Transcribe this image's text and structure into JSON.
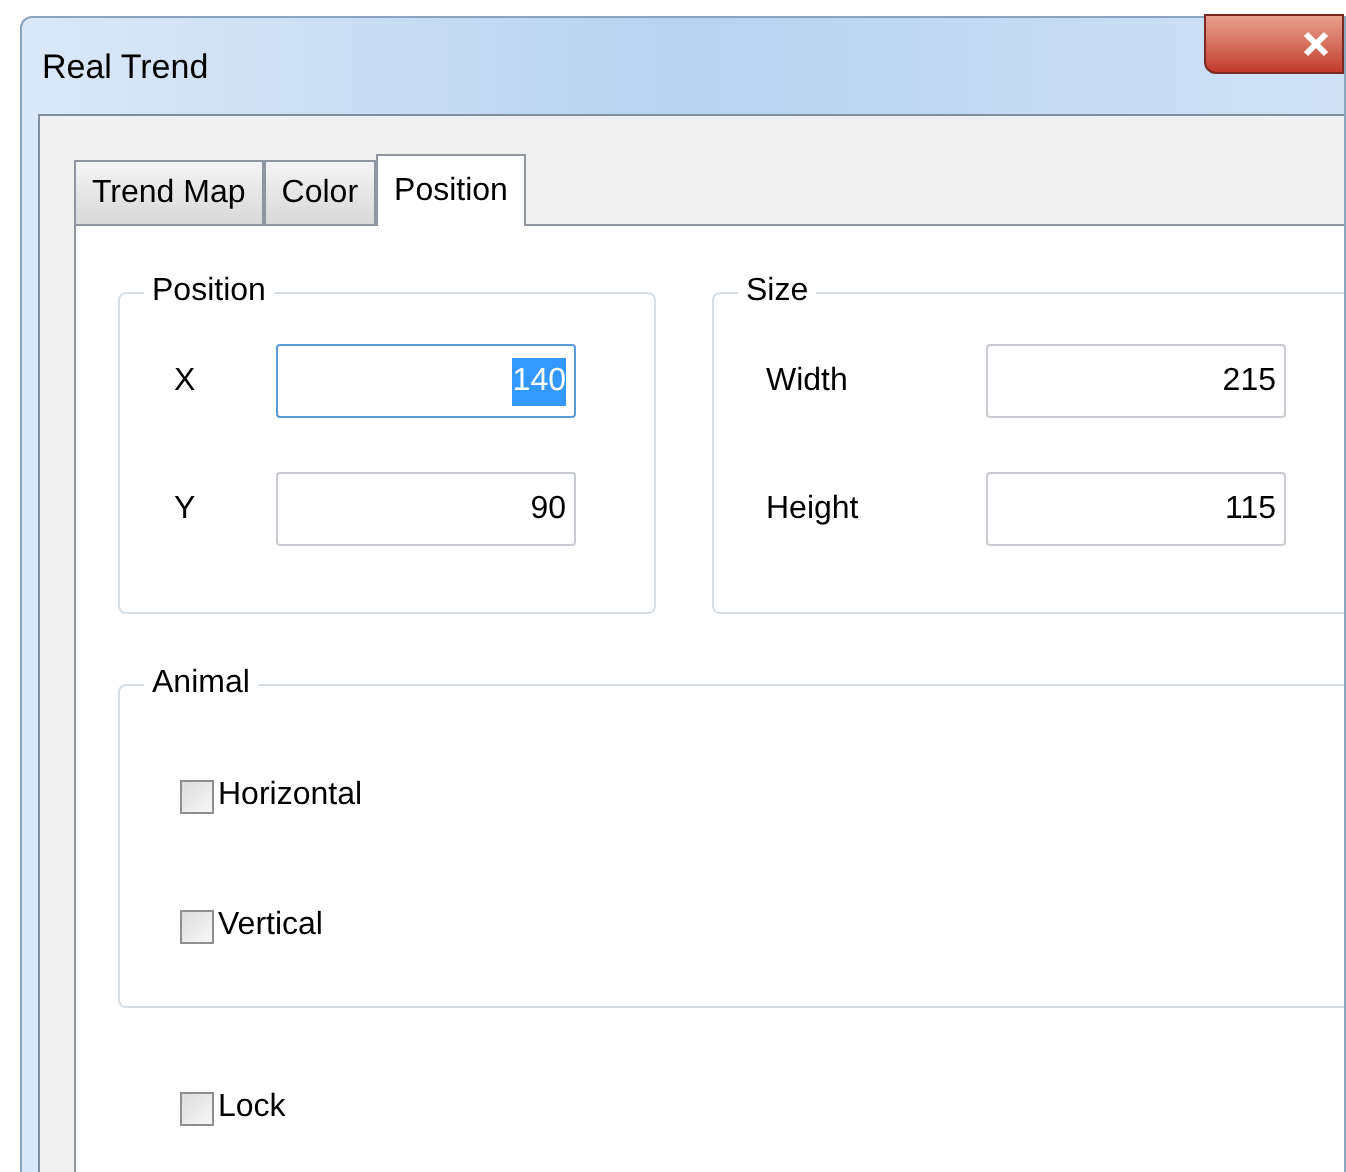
{
  "window": {
    "title": "Real Trend"
  },
  "tabs": [
    {
      "label": "Trend Map",
      "selected": false
    },
    {
      "label": "Color",
      "selected": false
    },
    {
      "label": "Position",
      "selected": true
    }
  ],
  "position_group": {
    "title": "Position",
    "fields": [
      {
        "label": "X",
        "value": "140",
        "focused": true
      },
      {
        "label": "Y",
        "value": "90",
        "focused": false
      }
    ]
  },
  "size_group": {
    "title": "Size",
    "fields": [
      {
        "label": "Width",
        "value": "215",
        "focused": false
      },
      {
        "label": "Height",
        "value": "115",
        "focused": false
      }
    ]
  },
  "animal_group": {
    "title": "Animal",
    "options": [
      {
        "label": "Horizontal",
        "checked": false
      },
      {
        "label": "Vertical",
        "checked": false
      }
    ]
  },
  "lock": {
    "label": "Lock",
    "checked": false
  }
}
